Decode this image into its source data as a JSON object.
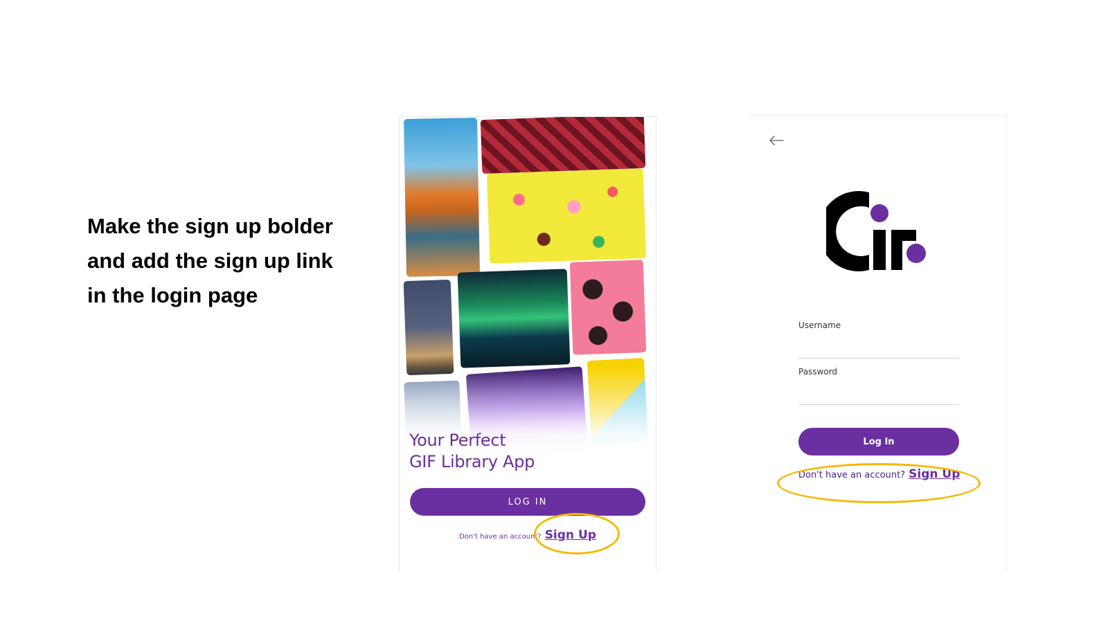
{
  "instruction": {
    "text": "Make the sign up bolder and add the sign up link in the login page"
  },
  "welcome_screen": {
    "tagline_line1": "Your Perfect",
    "tagline_line2": "GIF Library App",
    "login_button": "LOG IN",
    "signup_prompt": "Don't have an account?",
    "signup_link": "Sign Up"
  },
  "login_screen": {
    "back_icon": "arrow-left-icon",
    "logo": "gif-logo",
    "username_label": "Username",
    "username_value": "",
    "password_label": "Password",
    "password_value": "",
    "login_button": "Log In",
    "signup_prompt": "Don't have an account?",
    "signup_link": "Sign Up"
  },
  "colors": {
    "brand_purple": "#6a2fa0",
    "highlight_yellow": "#f5b800"
  }
}
